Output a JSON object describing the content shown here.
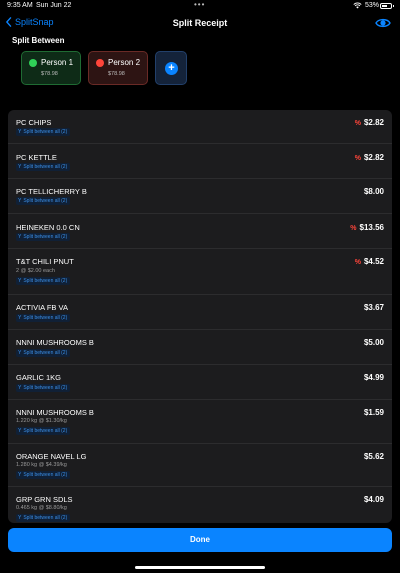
{
  "status_bar": {
    "time": "9:35 AM",
    "date": "Sun Jun 22",
    "battery": "53%"
  },
  "nav": {
    "back_label": "SplitSnap",
    "title": "Split Receipt"
  },
  "split_between": {
    "label": "Split Between",
    "people": [
      {
        "name": "Person 1",
        "amount": "$78.98",
        "color": "#30d158"
      },
      {
        "name": "Person 2",
        "amount": "$78.98",
        "color": "#ff453a"
      }
    ],
    "add_icon": "plus"
  },
  "items": [
    {
      "name": "PC CHIPS",
      "detail": "",
      "split": "Split between all (2)",
      "price": "$2.82",
      "percent": "%"
    },
    {
      "name": "PC KETTLE",
      "detail": "",
      "split": "Split between all (2)",
      "price": "$2.82",
      "percent": "%"
    },
    {
      "name": "PC TELLICHERRY B",
      "detail": "",
      "split": "Split between all (2)",
      "price": "$8.00",
      "percent": ""
    },
    {
      "name": "HEINEKEN 0.0 CN",
      "detail": "",
      "split": "Split between all (2)",
      "price": "$13.56",
      "percent": "%"
    },
    {
      "name": "T&T CHILI PNUT",
      "detail": "2 @  $2.00 each",
      "split": "Split between all (2)",
      "price": "$4.52",
      "percent": "%"
    },
    {
      "name": "ACTIVIA FB VA",
      "detail": "",
      "split": "Split between all (2)",
      "price": "$3.67",
      "percent": ""
    },
    {
      "name": "NNNI MUSHROOMS B",
      "detail": "",
      "split": "Split between all (2)",
      "price": "$5.00",
      "percent": ""
    },
    {
      "name": "GARLIC 1KG",
      "detail": "",
      "split": "Split between all (2)",
      "price": "$4.99",
      "percent": ""
    },
    {
      "name": "NNNI MUSHROOMS B",
      "detail": "1.220 kg   @ $1.30/kg",
      "split": "Split between all (2)",
      "price": "$1.59",
      "percent": ""
    },
    {
      "name": "ORANGE NAVEL LG",
      "detail": "1.280 kg   @ $4.39/kg",
      "split": "Split between all (2)",
      "price": "$5.62",
      "percent": ""
    },
    {
      "name": "GRP GRN SDLS",
      "detail": "0.465 kg   @ $8.80/kg",
      "split": "Split between all (2)",
      "price": "$4.09",
      "percent": ""
    }
  ],
  "done_label": "Done",
  "colors": {
    "accent": "#0a84ff",
    "person1": "#30d158",
    "person2": "#ff453a"
  }
}
